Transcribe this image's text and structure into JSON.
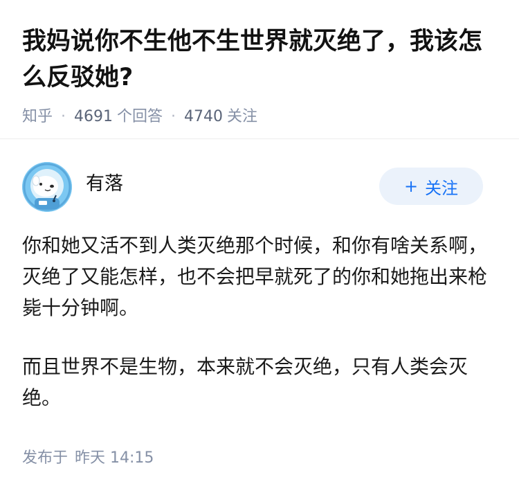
{
  "question": {
    "title": "我妈说你不生他不生世界就灭绝了，我该怎么反驳她?",
    "source": "知乎",
    "answer_count": "4691",
    "answer_label": "个回答",
    "follower_count": "4740",
    "follower_label": "关注"
  },
  "author": {
    "name": "有落",
    "follow_label": "关注",
    "follow_icon": "plus-icon",
    "avatar_icon": "astronaut-dog-avatar",
    "avatar_color": "#6ec1f0"
  },
  "answer": {
    "paragraphs": [
      "你和她又活不到人类灭绝那个时候，和你有啥关系啊，灭绝了又能怎样，也不会把早就死了的你和她拖出来枪毙十分钟啊。",
      "而且世界不是生物，本来就不会灭绝，只有人类会灭绝。"
    ],
    "published_label": "发布于",
    "published_time": "昨天 14:15"
  },
  "colors": {
    "accent": "#1772f6",
    "follow_bg": "#ebf2fb",
    "meta_text": "#8590a6"
  }
}
